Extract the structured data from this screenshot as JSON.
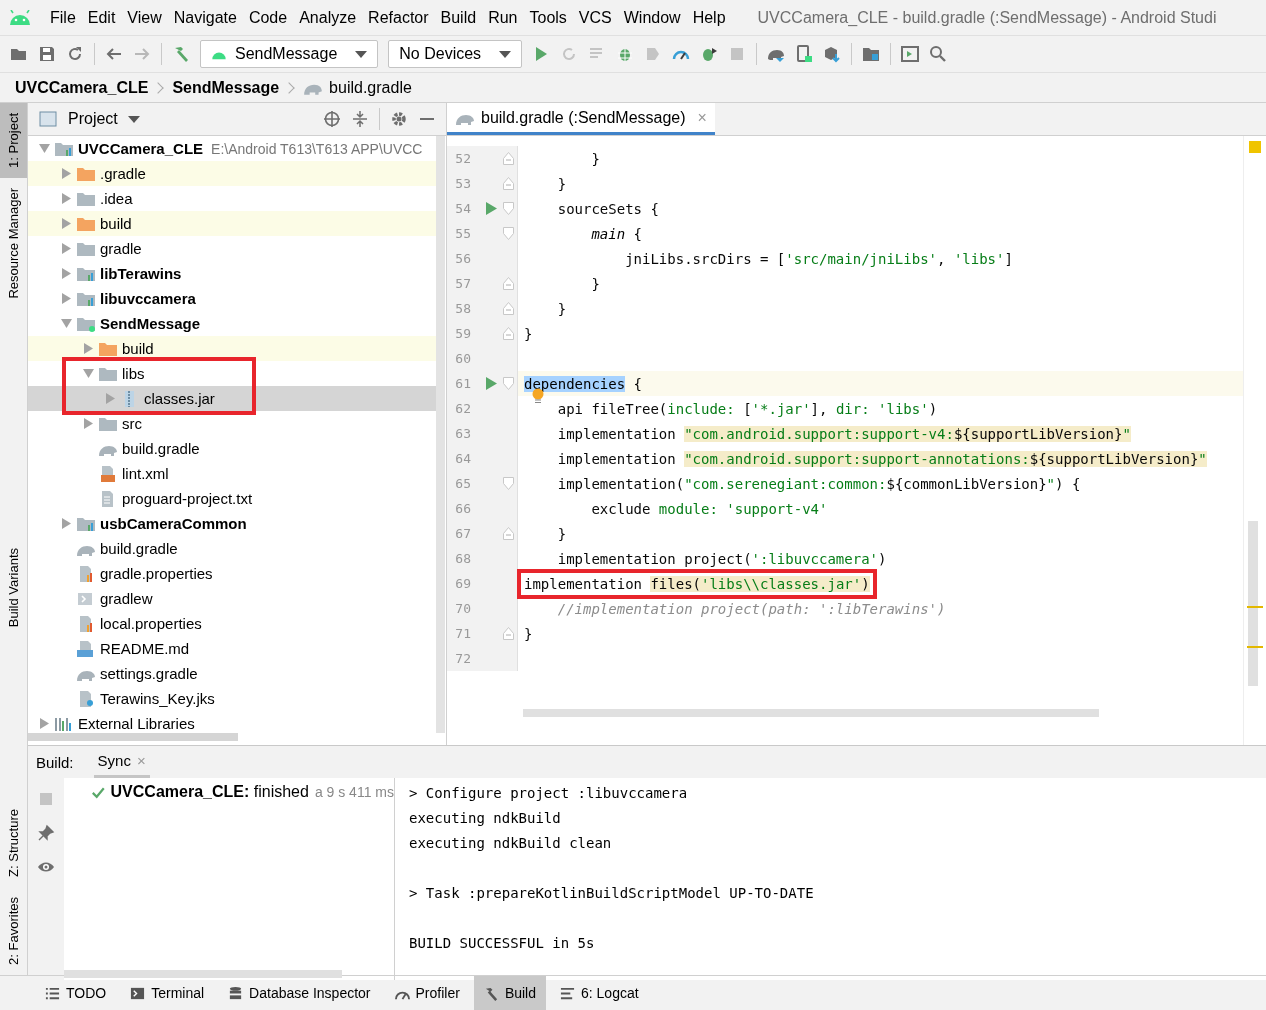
{
  "menu_bar": {
    "items": [
      "File",
      "Edit",
      "View",
      "Navigate",
      "Code",
      "Analyze",
      "Refactor",
      "Build",
      "Run",
      "Tools",
      "VCS",
      "Window",
      "Help"
    ],
    "window_title": "UVCCamera_CLE - build.gradle (:SendMessage) - Android Studi"
  },
  "toolbar": {
    "run_configuration": "SendMessage",
    "device": "No Devices"
  },
  "breadcrumb": [
    {
      "label": "UVCCamera_CLE",
      "kind": "module"
    },
    {
      "label": "SendMessage",
      "kind": "module"
    },
    {
      "label": "build.gradle",
      "kind": "file"
    }
  ],
  "left_strip": {
    "top": [
      {
        "label": "1: Project",
        "selected": true
      },
      {
        "label": "Resource Manager",
        "selected": false
      }
    ],
    "middle": [
      {
        "label": "Build Variants",
        "selected": false
      }
    ],
    "bottom": [
      {
        "label": "Z: Structure",
        "selected": false
      },
      {
        "label": "2: Favorites",
        "selected": false
      }
    ]
  },
  "project_panel": {
    "title": "Project",
    "tree": [
      {
        "label": "UVCCamera_CLE",
        "path": "E:\\Android T613\\T613 APP\\UVCC",
        "kind": "module",
        "bold": true,
        "expanded": true,
        "tinted": false,
        "selected": false,
        "marked": false,
        "children": [
          {
            "label": ".gradle",
            "kind": "folder_excluded",
            "bold": false,
            "expanded": false,
            "tinted": true,
            "selected": false,
            "marked": false
          },
          {
            "label": ".idea",
            "kind": "folder",
            "bold": false,
            "expanded": false,
            "tinted": false,
            "selected": false,
            "marked": false
          },
          {
            "label": "build",
            "kind": "folder_excluded",
            "bold": false,
            "expanded": false,
            "tinted": true,
            "selected": false,
            "marked": false
          },
          {
            "label": "gradle",
            "kind": "folder",
            "bold": false,
            "expanded": false,
            "tinted": false,
            "selected": false,
            "marked": false
          },
          {
            "label": "libTerawins",
            "kind": "module",
            "bold": true,
            "expanded": false,
            "tinted": false,
            "selected": false,
            "marked": false
          },
          {
            "label": "libuvccamera",
            "kind": "module",
            "bold": true,
            "expanded": false,
            "tinted": false,
            "selected": false,
            "marked": false
          },
          {
            "label": "SendMessage",
            "kind": "module_app",
            "bold": true,
            "expanded": true,
            "tinted": false,
            "selected": false,
            "marked": false,
            "children": [
              {
                "label": "build",
                "kind": "folder_excluded",
                "bold": false,
                "expanded": false,
                "tinted": true,
                "selected": false,
                "marked": false
              },
              {
                "label": "libs",
                "kind": "folder",
                "bold": false,
                "expanded": true,
                "tinted": false,
                "selected": false,
                "marked": true,
                "children": [
                  {
                    "label": "classes.jar",
                    "kind": "jar",
                    "bold": false,
                    "expanded": false,
                    "tinted": false,
                    "selected": true,
                    "marked": false
                  }
                ]
              },
              {
                "label": "src",
                "kind": "folder",
                "bold": false,
                "expanded": false,
                "tinted": false,
                "selected": false,
                "marked": false
              },
              {
                "label": "build.gradle",
                "kind": "gradle",
                "bold": false,
                "tinted": false,
                "selected": false,
                "marked": false
              },
              {
                "label": "lint.xml",
                "kind": "xml",
                "bold": false,
                "tinted": false,
                "selected": false,
                "marked": false
              },
              {
                "label": "proguard-project.txt",
                "kind": "text",
                "bold": false,
                "tinted": false,
                "selected": false,
                "marked": false
              }
            ]
          },
          {
            "label": "usbCameraCommon",
            "kind": "module",
            "bold": true,
            "expanded": false,
            "tinted": false,
            "selected": false,
            "marked": false
          },
          {
            "label": "build.gradle",
            "kind": "gradle",
            "bold": false,
            "tinted": false,
            "selected": false,
            "marked": false
          },
          {
            "label": "gradle.properties",
            "kind": "properties",
            "bold": false,
            "tinted": false,
            "selected": false,
            "marked": false
          },
          {
            "label": "gradlew",
            "kind": "script",
            "bold": false,
            "tinted": false,
            "selected": false,
            "marked": false
          },
          {
            "label": "local.properties",
            "kind": "properties",
            "bold": false,
            "tinted": false,
            "selected": false,
            "marked": false
          },
          {
            "label": "README.md",
            "kind": "markdown",
            "bold": false,
            "tinted": false,
            "selected": false,
            "marked": false
          },
          {
            "label": "settings.gradle",
            "kind": "gradle",
            "bold": false,
            "tinted": false,
            "selected": false,
            "marked": false
          },
          {
            "label": "Terawins_Key.jks",
            "kind": "keystore",
            "bold": false,
            "tinted": false,
            "selected": false,
            "marked": false
          }
        ]
      },
      {
        "label": "External Libraries",
        "kind": "libraries",
        "bold": false,
        "expanded": false,
        "tinted": false,
        "selected": false,
        "marked": false
      }
    ]
  },
  "editor": {
    "tabs": [
      {
        "label": "build.gradle (:SendMessage)",
        "close": "×",
        "selected": true
      }
    ],
    "lines": [
      {
        "n": "52",
        "run": false,
        "fold_start": false,
        "fold_end": true,
        "current": false,
        "marked": false,
        "intention": false,
        "tokens": [
          {
            "text": "        }",
            "kind": "plain"
          }
        ]
      },
      {
        "n": "53",
        "run": false,
        "fold_start": false,
        "fold_end": true,
        "current": false,
        "marked": false,
        "intention": false,
        "tokens": [
          {
            "text": "    }",
            "kind": "plain"
          }
        ]
      },
      {
        "n": "54",
        "run": true,
        "fold_start": true,
        "fold_end": false,
        "current": false,
        "marked": false,
        "intention": false,
        "tokens": [
          {
            "text": "    sourceSets {",
            "kind": "plain"
          }
        ]
      },
      {
        "n": "55",
        "run": false,
        "fold_start": true,
        "fold_end": false,
        "current": false,
        "marked": false,
        "intention": false,
        "tokens": [
          {
            "text": "        main",
            "kind": "italic"
          },
          {
            "text": " {",
            "kind": "plain"
          }
        ]
      },
      {
        "n": "56",
        "run": false,
        "fold_start": false,
        "fold_end": false,
        "current": false,
        "marked": false,
        "intention": false,
        "tokens": [
          {
            "text": "            jniLibs.srcDirs = [",
            "kind": "plain"
          },
          {
            "text": "'src/main/jniLibs'",
            "kind": "string"
          },
          {
            "text": ", ",
            "kind": "plain"
          },
          {
            "text": "'libs'",
            "kind": "string"
          },
          {
            "text": "]",
            "kind": "plain"
          }
        ]
      },
      {
        "n": "57",
        "run": false,
        "fold_start": false,
        "fold_end": true,
        "current": false,
        "marked": false,
        "intention": false,
        "tokens": [
          {
            "text": "        }",
            "kind": "plain"
          }
        ]
      },
      {
        "n": "58",
        "run": false,
        "fold_start": false,
        "fold_end": true,
        "current": false,
        "marked": false,
        "intention": false,
        "tokens": [
          {
            "text": "    }",
            "kind": "plain"
          }
        ]
      },
      {
        "n": "59",
        "run": false,
        "fold_start": false,
        "fold_end": true,
        "current": false,
        "marked": false,
        "intention": false,
        "tokens": [
          {
            "text": "}",
            "kind": "plain"
          }
        ]
      },
      {
        "n": "60",
        "run": false,
        "fold_start": false,
        "fold_end": false,
        "current": false,
        "marked": false,
        "intention": false
      },
      {
        "n": "61",
        "run": true,
        "fold_start": true,
        "fold_end": false,
        "current": true,
        "marked": false,
        "intention": false,
        "tokens": [
          {
            "text": "dependencies",
            "kind": "selected"
          },
          {
            "text": " {",
            "kind": "plain"
          }
        ]
      },
      {
        "n": "62",
        "run": false,
        "fold_start": false,
        "fold_end": false,
        "current": false,
        "marked": false,
        "intention": true,
        "tokens": [
          {
            "text": "    api fileTree(",
            "kind": "plain"
          },
          {
            "text": "include: ",
            "kind": "named"
          },
          {
            "text": "[",
            "kind": "plain"
          },
          {
            "text": "'*.jar'",
            "kind": "string"
          },
          {
            "text": "], ",
            "kind": "plain"
          },
          {
            "text": "dir: ",
            "kind": "named"
          },
          {
            "text": "'libs'",
            "kind": "string"
          },
          {
            "text": ")",
            "kind": "plain"
          }
        ]
      },
      {
        "n": "63",
        "run": false,
        "fold_start": false,
        "fold_end": false,
        "current": false,
        "marked": false,
        "intention": false,
        "tokens": [
          {
            "text": "    implementation ",
            "kind": "plain"
          },
          {
            "text": "\"com.android.support:support-v4:",
            "kind": "string_hl"
          },
          {
            "text": "${supportLibVersion}",
            "kind": "plain_hl"
          },
          {
            "text": "\"",
            "kind": "string_hl"
          }
        ]
      },
      {
        "n": "64",
        "run": false,
        "fold_start": false,
        "fold_end": false,
        "current": false,
        "marked": false,
        "intention": false,
        "tokens": [
          {
            "text": "    implementation ",
            "kind": "plain"
          },
          {
            "text": "\"com.android.support:support-annotations:",
            "kind": "string_hl"
          },
          {
            "text": "${supportLibVersion}",
            "kind": "plain_hl"
          },
          {
            "text": "\"",
            "kind": "string_hl"
          }
        ]
      },
      {
        "n": "65",
        "run": false,
        "fold_start": true,
        "fold_end": false,
        "current": false,
        "marked": false,
        "intention": false,
        "tokens": [
          {
            "text": "    implementation(",
            "kind": "plain"
          },
          {
            "text": "\"com.serenegiant:common:",
            "kind": "string"
          },
          {
            "text": "${commonLibVersion}",
            "kind": "plain"
          },
          {
            "text": "\"",
            "kind": "string"
          },
          {
            "text": ") {",
            "kind": "plain"
          }
        ]
      },
      {
        "n": "66",
        "run": false,
        "fold_start": false,
        "fold_end": false,
        "current": false,
        "marked": false,
        "intention": false,
        "tokens": [
          {
            "text": "        exclude ",
            "kind": "plain"
          },
          {
            "text": "module: ",
            "kind": "named"
          },
          {
            "text": "'support-v4'",
            "kind": "string"
          }
        ]
      },
      {
        "n": "67",
        "run": false,
        "fold_start": false,
        "fold_end": true,
        "current": false,
        "marked": false,
        "intention": false,
        "tokens": [
          {
            "text": "    }",
            "kind": "plain"
          }
        ]
      },
      {
        "n": "68",
        "run": false,
        "fold_start": false,
        "fold_end": false,
        "current": false,
        "marked": false,
        "intention": false,
        "tokens": [
          {
            "text": "    implementation project(",
            "kind": "plain"
          },
          {
            "text": "':libuvccamera'",
            "kind": "string"
          },
          {
            "text": ")",
            "kind": "plain"
          }
        ]
      },
      {
        "n": "69",
        "run": false,
        "fold_start": false,
        "fold_end": false,
        "current": false,
        "marked": true,
        "intention": false,
        "tokens": [
          {
            "text": "implementation ",
            "kind": "plain"
          },
          {
            "text": "files(",
            "kind": "plain_hl"
          },
          {
            "text": "'libs\\\\classes.jar'",
            "kind": "string_hl"
          },
          {
            "text": ")",
            "kind": "plain_hl"
          }
        ]
      },
      {
        "n": "70",
        "run": false,
        "fold_start": false,
        "fold_end": false,
        "current": false,
        "marked": false,
        "intention": false,
        "tokens": [
          {
            "text": "    //implementation project(path: ':libTerawins')",
            "kind": "comment"
          }
        ]
      },
      {
        "n": "71",
        "run": false,
        "fold_start": false,
        "fold_end": true,
        "current": false,
        "marked": false,
        "intention": false,
        "tokens": [
          {
            "text": "}",
            "kind": "plain"
          }
        ]
      },
      {
        "n": "72",
        "run": false,
        "fold_start": false,
        "fold_end": false,
        "current": false,
        "marked": false,
        "intention": false
      }
    ]
  },
  "build_panel": {
    "label": "Build:",
    "tabs": [
      {
        "label": "Sync",
        "close": "×",
        "selected": true
      }
    ],
    "events": [
      {
        "text": "**UVCCamera_CLE:** finished",
        "time": "a 9 s 411 ms"
      }
    ],
    "console": [
      [
        "> Configure project :libuvccamera",
        "executing ndkBuild",
        "executing ndkBuild clean"
      ],
      [
        "> Task :prepareKotlinBuildScriptModel UP-TO-DATE"
      ],
      [
        "BUILD SUCCESSFUL in 5s"
      ]
    ]
  },
  "bottom_bar": [
    {
      "label": "TODO",
      "kind": "todo",
      "selected": false
    },
    {
      "label": "Terminal",
      "kind": "terminal",
      "selected": false
    },
    {
      "label": "Database Inspector",
      "kind": "database",
      "selected": false
    },
    {
      "label": "Profiler",
      "kind": "profiler",
      "selected": false
    },
    {
      "label": "Build",
      "kind": "build",
      "selected": true
    },
    {
      "label": "6: Logcat",
      "kind": "logcat",
      "selected": false
    }
  ]
}
